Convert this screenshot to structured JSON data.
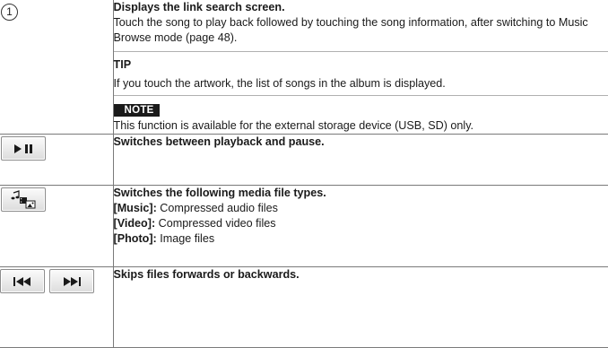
{
  "rows": [
    {
      "marker": "1",
      "title": "Displays the link search screen.",
      "description": "Touch the song to play back followed by touching the song information, after switching to Music Browse mode (page 48).",
      "tip_label": "TIP",
      "tip_text": "If you touch the artwork, the list of songs in the album is displayed.",
      "note_label": "NOTE",
      "note_text": "This function is available for the external storage device (USB, SD) only."
    },
    {
      "icon": "play-pause-icon",
      "title": "Switches between playback and pause."
    },
    {
      "icon": "media-type-icon",
      "title": "Switches the following media file types.",
      "items": [
        {
          "label": "[Music]:",
          "text": " Compressed audio files"
        },
        {
          "label": "[Video]:",
          "text": " Compressed video files"
        },
        {
          "label": "[Photo]:",
          "text": " Image files"
        }
      ]
    },
    {
      "icons": [
        "skip-previous-icon",
        "skip-next-icon"
      ],
      "title": "Skips files forwards or backwards."
    }
  ]
}
